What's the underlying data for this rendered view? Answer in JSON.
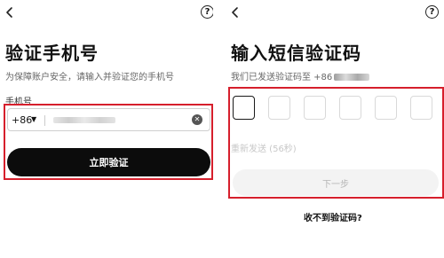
{
  "left_screen": {
    "help_icon_glyph": "?",
    "title": "验证手机号",
    "subtitle": "为保障账户安全，请输入并验证您的手机号",
    "phone_label": "手机号",
    "country_code": "+86",
    "country_caret": "▼",
    "clear_glyph": "✕",
    "verify_button": "立即验证"
  },
  "right_screen": {
    "help_icon_glyph": "?",
    "title": "输入短信验证码",
    "subtitle_prefix": "我们已发送验证码至 +86",
    "resend_text": "重新发送 (56秒)",
    "next_button": "下一步",
    "no_code_link": "收不到验证码?"
  },
  "colors": {
    "highlight": "#d61f2c",
    "primary_button": "#0c0c0c",
    "disabled_button": "#f3f3f3"
  }
}
